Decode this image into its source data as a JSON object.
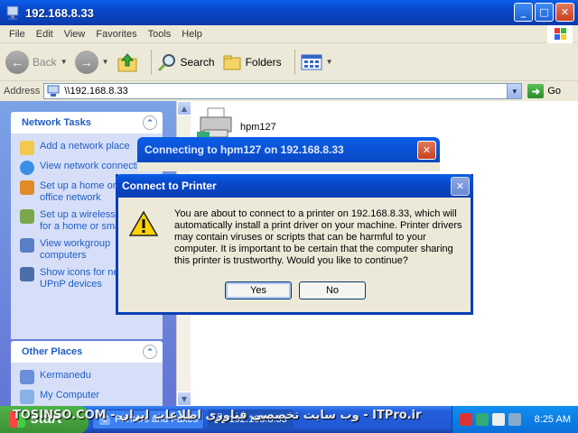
{
  "window": {
    "title": "192.168.8.33"
  },
  "menu": [
    "File",
    "Edit",
    "View",
    "Favorites",
    "Tools",
    "Help"
  ],
  "toolbar": {
    "back": "Back",
    "search": "Search",
    "folders": "Folders"
  },
  "address": {
    "label": "Address",
    "value": "\\\\192.168.8.33",
    "go": "Go"
  },
  "network_tasks": {
    "title": "Network Tasks",
    "items": [
      {
        "label": "Add a network place",
        "icon": "add-network-place-icon"
      },
      {
        "label": "View network connections",
        "icon": "network-connections-icon"
      },
      {
        "label": "Set up a home or small office network",
        "icon": "home-network-icon"
      },
      {
        "label": "Set up a wireless network for a home or small office",
        "icon": "wireless-network-icon"
      },
      {
        "label": "View workgroup computers",
        "icon": "workgroup-icon"
      },
      {
        "label": "Show icons for networked UPnP devices",
        "icon": "upnp-icon"
      }
    ]
  },
  "other_places": {
    "title": "Other Places",
    "items": [
      {
        "label": "Kermanedu",
        "icon": "network-computer-icon"
      },
      {
        "label": "My Computer",
        "icon": "my-computer-icon"
      }
    ]
  },
  "content": {
    "printer_name": "hpm127"
  },
  "connecting_dialog": {
    "title": "Connecting to hpm127 on 192.168.8.33"
  },
  "dialog": {
    "title": "Connect to Printer",
    "message": "You are about to connect to a printer on 192.168.8.33, which will automatically install a print driver on your machine.  Printer drivers may contain viruses or scripts that can be harmful to your computer.  It is important to be certain that the computer sharing this printer is trustworthy.  Would you like to continue?",
    "yes": "Yes",
    "no": "No"
  },
  "taskbar": {
    "start": "start",
    "tasks": [
      "Printers and Faxes",
      "192.168.8.33"
    ],
    "clock": "8:25 AM",
    "watermark": "TOSINSO.COM - وب سایت تخصصی فناوری اطلاعات ایران - ITPro.ir"
  }
}
